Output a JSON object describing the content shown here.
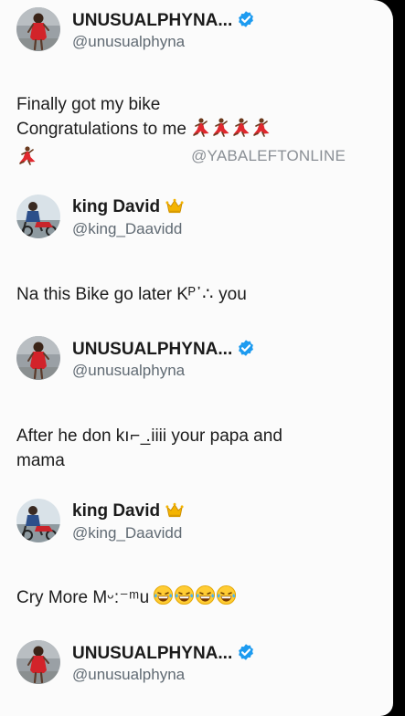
{
  "posts": [
    {
      "name": "UNUSUALPHYNA...",
      "handle": "@unusualphyna",
      "verified": true,
      "avatar_icon": "woman-red-dress-avatar",
      "text_line1": "Finally got my bike",
      "text_line2": "Congratulations to me",
      "emoji": "dancer-emoji"
    },
    {
      "name": "king David",
      "handle": "@king_Daavidd",
      "crown": "crown-emoji",
      "avatar_icon": "man-bike-avatar",
      "text_before": "Na this Bike go later K",
      "text_obscured": "ᴾ᾽∴",
      "text_after": " you"
    },
    {
      "name": "UNUSUALPHYNA...",
      "handle": "@unusualphyna",
      "verified": true,
      "avatar_icon": "woman-red-dress-avatar",
      "text_before": "After he don k",
      "text_obscured": "ı⌐ ̲.",
      "text_after": "iiii your papa and",
      "text_line2": "mama"
    },
    {
      "name": "king David",
      "handle": "@king_Daavidd",
      "crown": "crown-emoji",
      "avatar_icon": "man-bike-avatar",
      "text_before": "Cry More M",
      "text_obscured": "ᵕ:⁻ᵐ",
      "text_after": "u",
      "emoji": "laughing-emoji"
    },
    {
      "name": "UNUSUALPHYNA...",
      "handle": "@unusualphyna",
      "verified": true,
      "avatar_icon": "woman-red-dress-avatar"
    }
  ],
  "watermark": "@YABALEFTONLINE",
  "colors": {
    "verified": "#1d9bf0",
    "text": "#1c1c1c",
    "handle": "#606a73",
    "dress": "#d2232a"
  }
}
